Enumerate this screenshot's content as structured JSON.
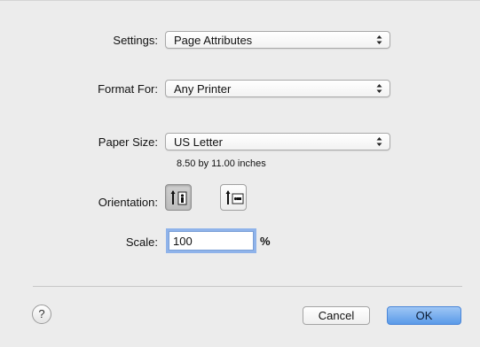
{
  "settings": {
    "label": "Settings:",
    "value": "Page Attributes"
  },
  "format_for": {
    "label": "Format For:",
    "value": "Any Printer"
  },
  "paper_size": {
    "label": "Paper Size:",
    "value": "US Letter",
    "dimensions": "8.50 by 11.00 inches"
  },
  "orientation": {
    "label": "Orientation:",
    "options": [
      {
        "name": "portrait",
        "icon": "portrait-icon",
        "selected": true
      },
      {
        "name": "landscape",
        "icon": "landscape-icon",
        "selected": false
      }
    ]
  },
  "scale": {
    "label": "Scale:",
    "value": "100",
    "unit": "%"
  },
  "buttons": {
    "help": "?",
    "cancel": "Cancel",
    "ok": "OK"
  },
  "colors": {
    "ok_button": "#5a9ae8",
    "focus_ring": "#8fb3ea",
    "background": "#ececec"
  }
}
